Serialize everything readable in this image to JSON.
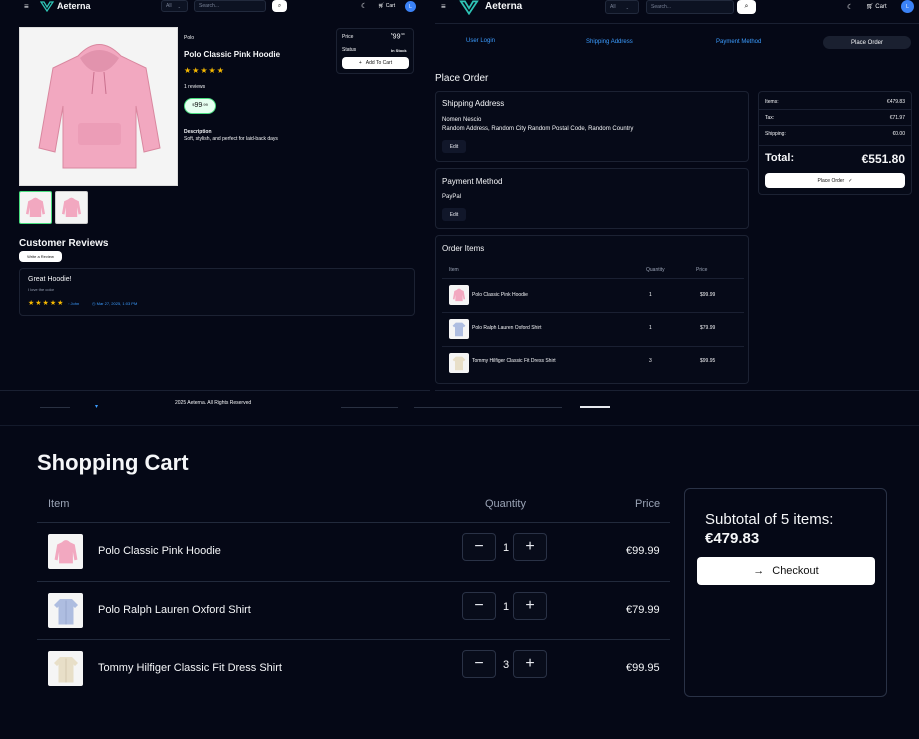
{
  "nav": {
    "brand": "Aeterna",
    "select_value": "All",
    "search_placeholder": "Search...",
    "cart_label": "Cart",
    "avatar_initial": "L"
  },
  "product": {
    "brand": "Polo",
    "name": "Polo Classic Pink Hoodie",
    "rating_stars": "★★★★★",
    "reviews_count": "1 reviews",
    "price_symbol": "$",
    "price_main": "99",
    "price_cents": ".99",
    "description_label": "Description",
    "description": "Soft, stylish, and perfect for laid-back days",
    "price_label": "Price",
    "status_label": "Status",
    "status_value": "In Stock",
    "add_to_cart": "Add To Cart",
    "reviews_heading": "Customer Reviews",
    "write_review": "Write a Review",
    "review": {
      "title": "Great Hoodie!",
      "body": "I love the color",
      "stars": "★★★★★",
      "author": "John",
      "date": "Mar 27, 2025, 1:03 PM"
    }
  },
  "footer": {
    "text": "2025 Aeterna. All Rights Reserved"
  },
  "checkout": {
    "steps": [
      "User Login",
      "Shipping Address",
      "Payment Method",
      "Place Order"
    ],
    "page_title": "Place Order",
    "shipping_heading": "Shipping Address",
    "shipping_name": "Nomen Nescio",
    "shipping_address": "Random Address, Random City Random Postal Code, Random Country",
    "edit_label": "Edit",
    "payment_heading": "Payment Method",
    "payment_value": "PayPal",
    "order_items_heading": "Order Items",
    "col_item": "Item",
    "col_quantity": "Quantity",
    "col_price": "Price",
    "items": [
      {
        "name": "Polo Classic Pink Hoodie",
        "qty": "1",
        "price": "$99.99"
      },
      {
        "name": "Polo Ralph Lauren Oxford Shirt",
        "qty": "1",
        "price": "$79.99"
      },
      {
        "name": "Tommy Hilfiger Classic Fit Dress Shirt",
        "qty": "3",
        "price": "$99.95"
      }
    ],
    "summary": {
      "items_label": "Items:",
      "items_value": "€479.83",
      "tax_label": "Tax:",
      "tax_value": "€71.97",
      "shipping_label": "Shipping:",
      "shipping_value": "€0.00",
      "total_label": "Total:",
      "total_value": "€551.80",
      "place_order": "Place Order"
    }
  },
  "cart": {
    "title": "Shopping Cart",
    "col_item": "Item",
    "col_quantity": "Quantity",
    "col_price": "Price",
    "items": [
      {
        "name": "Polo Classic Pink Hoodie",
        "qty": "1",
        "price": "€99.99"
      },
      {
        "name": "Polo Ralph Lauren Oxford Shirt",
        "qty": "1",
        "price": "€79.99"
      },
      {
        "name": "Tommy Hilfiger Classic Fit Dress Shirt",
        "qty": "3",
        "price": "€99.95"
      }
    ],
    "minus": "−",
    "plus": "+",
    "subtotal_label": "Subtotal of 5 items:",
    "subtotal_value": "€479.83",
    "checkout_button": "Checkout"
  },
  "colors": {
    "background": "#050816",
    "accent_blue": "#3b9cff",
    "star": "#f5b800",
    "hoodie_pink": "#f2a8c0",
    "oxford_blue": "#aebde0",
    "dress_shirt_beige": "#e8dfc8"
  }
}
